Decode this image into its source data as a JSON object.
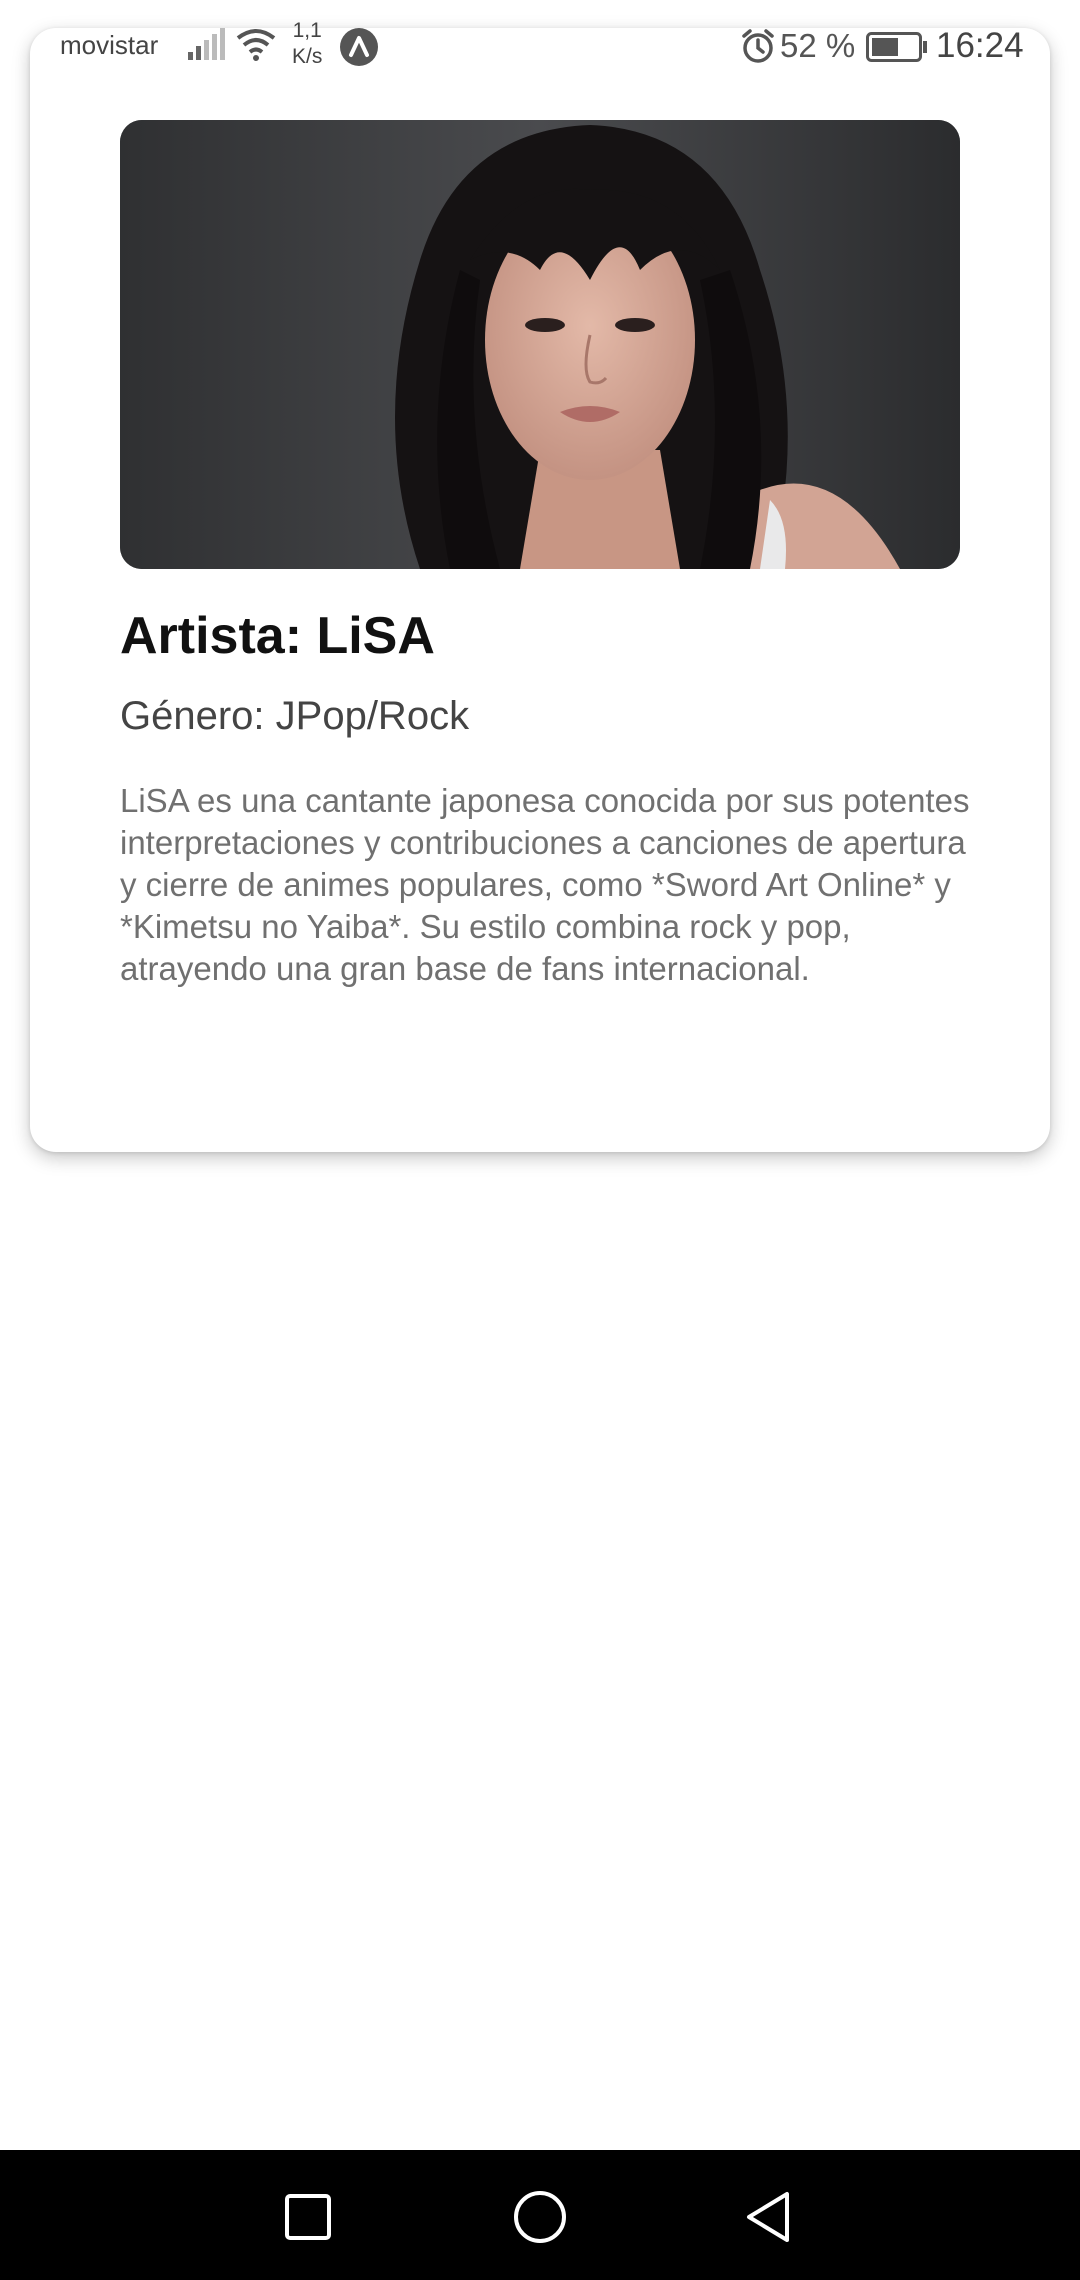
{
  "status_bar": {
    "carrier": "movistar",
    "speed_top": "1,1",
    "speed_bottom": "K/s",
    "battery_percent": "52 %",
    "time": "16:24",
    "icons": [
      "signal-icon",
      "wifi-icon",
      "app-notification-icon",
      "alarm-icon",
      "battery-icon"
    ]
  },
  "artist_card": {
    "image": "artist-portrait",
    "title": "Artista: LiSA",
    "genre": "Género: JPop/Rock",
    "description": "LiSA es una cantante japonesa conocida por sus potentes interpretaciones y contribuciones a canciones de apertura y cierre de animes populares, como *Sword Art Online* y *Kimetsu no Yaiba*. Su estilo combina rock y pop, atrayendo una gran base de fans internacional."
  },
  "nav_bar": {
    "buttons": [
      "recents-button",
      "home-button",
      "back-button"
    ]
  },
  "colors": {
    "background": "#ffffff",
    "title": "#111111",
    "genre": "#444444",
    "description": "#707070",
    "nav_bar": "#000000"
  }
}
